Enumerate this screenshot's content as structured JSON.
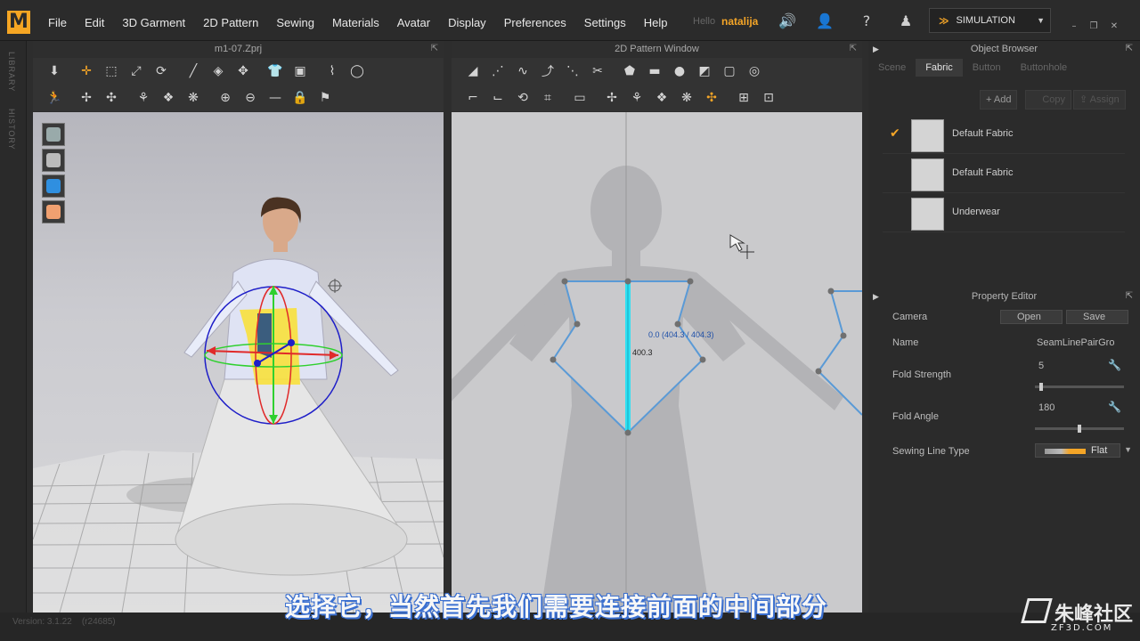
{
  "menu": {
    "logo": "M",
    "items": [
      "File",
      "Edit",
      "3D Garment",
      "2D Pattern",
      "Sewing",
      "Materials",
      "Avatar",
      "Display",
      "Preferences",
      "Settings",
      "Help"
    ],
    "hello": "Hello",
    "user": "natalija",
    "simulation": "SIMULATION"
  },
  "sidebar": {
    "library": "LIBRARY",
    "history": "HISTORY"
  },
  "panels": {
    "left_title": "m1-07.Zprj",
    "center_title": "2D Pattern Window",
    "object_browser_title": "Object Browser",
    "property_editor_title": "Property Editor"
  },
  "object_browser": {
    "tabs": [
      "Scene",
      "Fabric",
      "Button",
      "Buttonhole"
    ],
    "active_tab": "Fabric",
    "add": "Add",
    "copy": "Copy",
    "assign": "Assign",
    "fabrics": [
      {
        "name": "Default Fabric",
        "selected": true
      },
      {
        "name": "Default Fabric",
        "selected": false
      },
      {
        "name": "Underwear",
        "selected": false
      }
    ]
  },
  "property_editor": {
    "camera_label": "Camera",
    "open": "Open",
    "save": "Save",
    "name_label": "Name",
    "name_value": "SeamLinePairGro",
    "fold_strength_label": "Fold Strength",
    "fold_strength_value": "5",
    "fold_strength_fraction": 0.05,
    "fold_angle_label": "Fold Angle",
    "fold_angle_value": "180",
    "fold_angle_fraction": 0.5,
    "sewing_line_type_label": "Sewing Line Type",
    "sewing_line_type_value": "Flat"
  },
  "pattern_window": {
    "measure_label": "0.0 (404.3 / 404.3)",
    "seam_label": "400.3"
  },
  "status": {
    "version": "Version: 3.1.22",
    "build": "(r24685)"
  },
  "subtitle": "选择它，当然首先我们需要连接前面的中间部分",
  "watermark": {
    "brand": "朱峰社区",
    "site": "ZF3D.COM"
  },
  "colors": {
    "accent": "#f4a527",
    "seam": "#2fe0f2",
    "pattern_edge": "#5a9ad6"
  }
}
